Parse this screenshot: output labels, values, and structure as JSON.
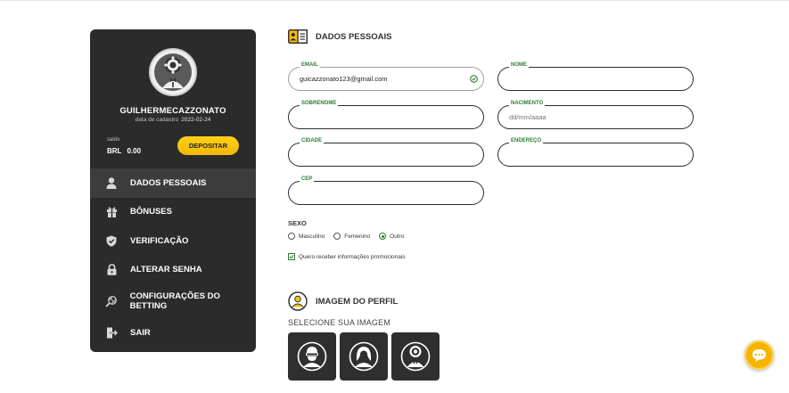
{
  "user": {
    "username": "GUILHERMECAZZONATO",
    "reg_label": "data de cadastro",
    "reg_date": "2022-02-24",
    "saldo_label": "saldo",
    "currency": "BRL",
    "balance": "0.00",
    "deposit_label": "DEPOSITAR"
  },
  "menu": {
    "items": [
      {
        "label": "DADOS PESSOAIS",
        "icon": "user-icon",
        "active": true
      },
      {
        "label": "BÔNUSES",
        "icon": "gift-icon"
      },
      {
        "label": "VERIFICAÇÃO",
        "icon": "shield-check-icon"
      },
      {
        "label": "ALTERAR SENHA",
        "icon": "lock-icon"
      },
      {
        "label": "CONFIGURAÇÕES DO BETTING",
        "icon": "settings-ball-icon"
      },
      {
        "label": "SAIR",
        "icon": "logout-icon"
      }
    ]
  },
  "personal": {
    "title": "DADOS PESSOAIS",
    "fields": {
      "email": {
        "label": "EMAIL",
        "value": "guicazzonato123@gmail.com",
        "placeholder": ""
      },
      "nome": {
        "label": "NOME",
        "value": "",
        "placeholder": ""
      },
      "sobrenome": {
        "label": "SOBRENOME",
        "value": "",
        "placeholder": ""
      },
      "nascimento": {
        "label": "NACIMENTO",
        "value": "",
        "placeholder": "dd/mm/aaaa"
      },
      "cidade": {
        "label": "CIDADE",
        "value": "",
        "placeholder": ""
      },
      "endereco": {
        "label": "ENDEREÇO",
        "value": "",
        "placeholder": ""
      },
      "cep": {
        "label": "CEP",
        "value": "",
        "placeholder": ""
      }
    },
    "sexo": {
      "label": "SEXO",
      "options": [
        "Masculino",
        "Femenino",
        "Outro"
      ],
      "selected": "Outro"
    },
    "promo": {
      "label": "Quero receber informações promocionais",
      "checked": true
    }
  },
  "profile_image": {
    "title": "IMAGEM DO PERFIL",
    "select_label": "SELECIONE SUA IMAGEM",
    "options": [
      "man-avatar-icon",
      "woman-avatar-icon",
      "poker-avatar-icon"
    ]
  },
  "colors": {
    "sidebar_bg": "#2b2b2b",
    "accent_yellow": "#f4b400",
    "label_green": "#2e7d32"
  }
}
